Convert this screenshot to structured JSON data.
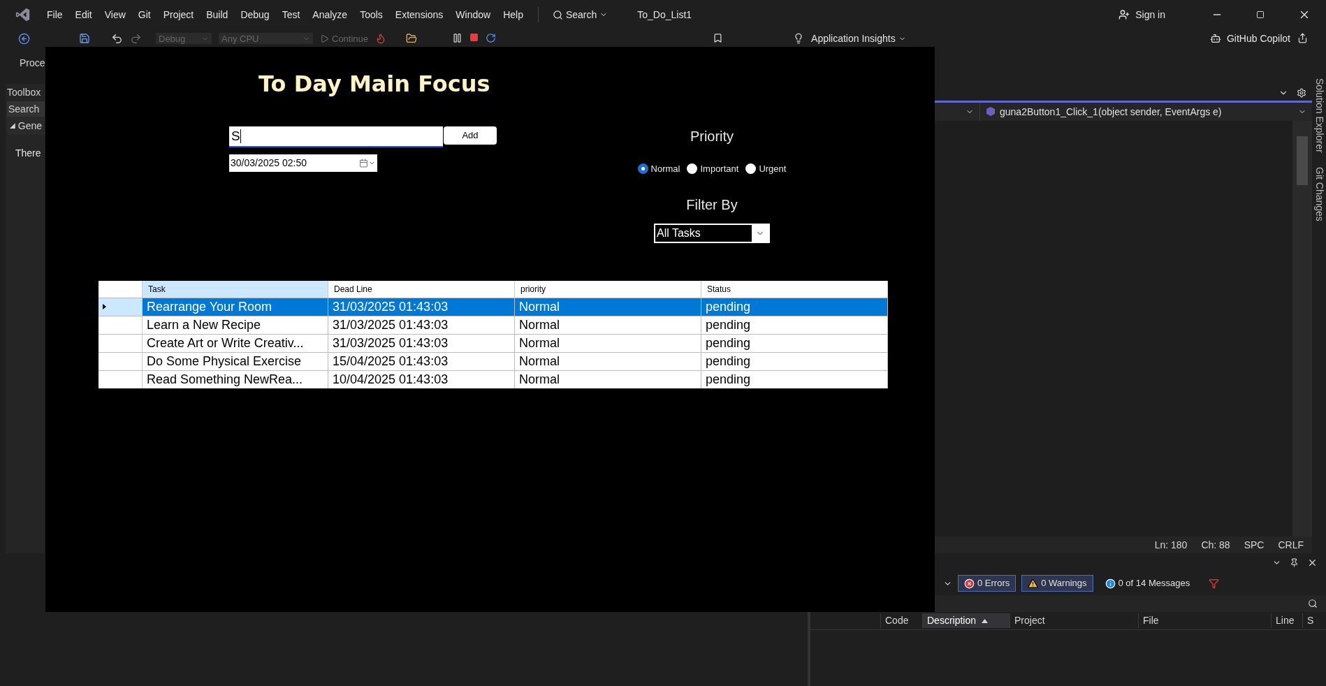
{
  "menu_bar": {
    "items": [
      "File",
      "Edit",
      "View",
      "Git",
      "Project",
      "Build",
      "Debug",
      "Test",
      "Analyze",
      "Tools",
      "Extensions",
      "Window",
      "Help"
    ],
    "search": "Search",
    "solution_name": "To_Do_List1",
    "sign_in": "Sign in"
  },
  "toolbar": {
    "configuration": "Debug",
    "platform": "Any CPU",
    "continue": "Continue",
    "application_insights": "Application Insights",
    "copilot": "GitHub Copilot"
  },
  "toolbar_row2": {
    "label": "Proce"
  },
  "toolbox": {
    "title": "Toolbox",
    "search": "Search",
    "group": "Gene",
    "group_expanded": true,
    "message": "There"
  },
  "editor": {
    "member": "guna2Button1_Click_1(object sender, EventArgs e)",
    "status": [
      "Ln: 180",
      "Ch: 88",
      "SPC",
      "CRLF"
    ]
  },
  "side_tabs": [
    "Solution Explorer",
    "Git Changes"
  ],
  "error_list": {
    "filters": [
      {
        "kind": "error",
        "label": "0 Errors",
        "on": true
      },
      {
        "kind": "warning",
        "label": "0 Warnings",
        "on": true
      },
      {
        "kind": "message",
        "label": "0 of 14 Messages",
        "on": false
      }
    ],
    "columns": [
      {
        "label": "Code",
        "sorted": false
      },
      {
        "label": "Description",
        "sorted": true
      },
      {
        "label": "Project",
        "sorted": false
      },
      {
        "label": "File",
        "sorted": false
      },
      {
        "label": "Line",
        "sorted": false
      },
      {
        "label": "S",
        "sorted": false
      }
    ]
  },
  "app": {
    "title": "To Day Main Focus",
    "task_input": {
      "value": "S"
    },
    "add_button": "Add",
    "deadline": "30/03/2025 02:50",
    "priority": {
      "label": "Priority",
      "options": [
        {
          "label": "Normal",
          "selected": true
        },
        {
          "label": "Important",
          "selected": false
        },
        {
          "label": "Urgent",
          "selected": false
        }
      ]
    },
    "filter": {
      "label": "Filter By",
      "value": "All Tasks"
    },
    "table": {
      "columns": [
        "Task",
        "Dead Line",
        "priority",
        "Status"
      ],
      "rows": [
        {
          "cells": [
            "Rearrange Your Room",
            "31/03/2025 01:43:03",
            "Normal",
            "pending"
          ],
          "selected": true
        },
        {
          "cells": [
            "Learn a New Recipe",
            "31/03/2025 01:43:03",
            "Normal",
            "pending"
          ],
          "selected": false
        },
        {
          "cells": [
            "Create Art or Write Creativ...",
            "31/03/2025 01:43:03",
            "Normal",
            "pending"
          ],
          "selected": false
        },
        {
          "cells": [
            "Do Some Physical Exercise",
            "15/04/2025 01:43:03",
            "Normal",
            "pending"
          ],
          "selected": false
        },
        {
          "cells": [
            "Read Something NewRea...",
            "10/04/2025 01:43:03",
            "Normal",
            "pending"
          ],
          "selected": false
        }
      ]
    }
  }
}
